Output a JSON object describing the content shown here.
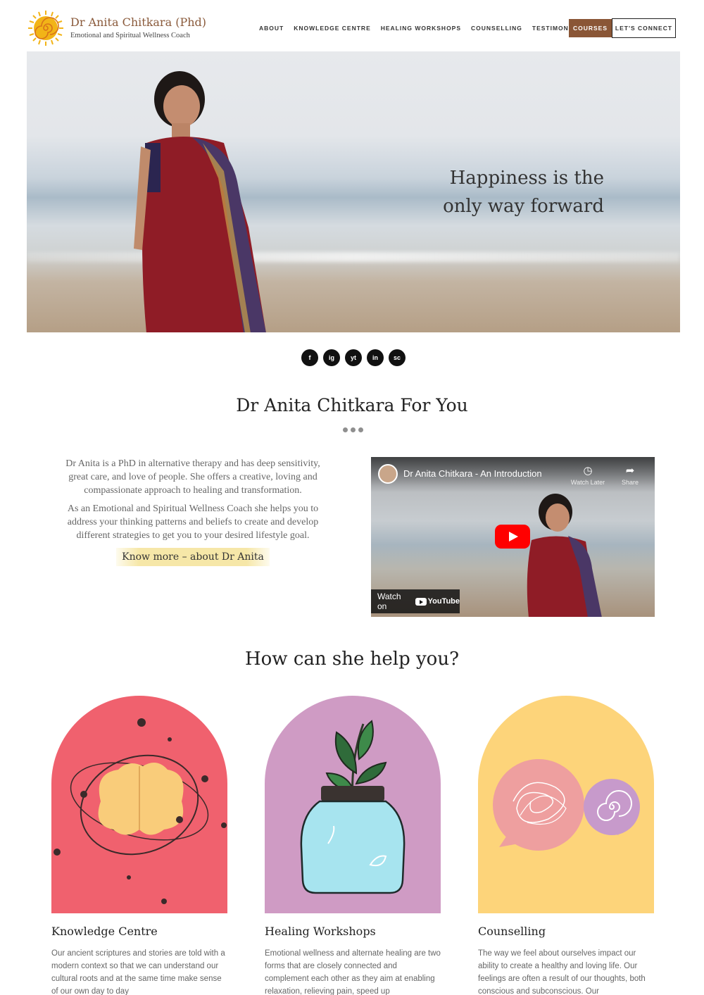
{
  "header": {
    "brand_title": "Dr Anita Chitkara (Phd)",
    "brand_subtitle": "Emotional and Spiritual Wellness Coach",
    "nav": [
      "ABOUT",
      "KNOWLEDGE CENTRE",
      "HEALING WORKSHOPS",
      "COUNSELLING",
      "TESTIMONIALS"
    ],
    "courses_label": "COURSES",
    "connect_label": "LET'S CONNECT"
  },
  "hero": {
    "quote_line1": "Happiness is the",
    "quote_line2": "only way forward"
  },
  "socials": [
    "f",
    "ig",
    "yt",
    "in",
    "sc"
  ],
  "about": {
    "title": "Dr Anita Chitkara For You",
    "paragraph1": "Dr Anita is a PhD in alternative therapy and has deep sensitivity, great care, and love of people. She offers a creative, loving and compassionate approach to healing and transformation.",
    "paragraph2": "As an Emotional and Spiritual Wellness Coach she helps you to address your thinking patterns and beliefs to create and develop different strategies to get you to your desired lifestyle goal.",
    "know_more": "Know more – about Dr Anita"
  },
  "video": {
    "title": "Dr Anita Chitkara - An Introduction",
    "watch_later": "Watch Later",
    "share": "Share",
    "watch_on": "Watch on",
    "youtube": "YouTube"
  },
  "help": {
    "title": "How can she help you?",
    "cards": [
      {
        "title": "Knowledge Centre",
        "text": "Our ancient scriptures and stories are told with a modern context so that we can understand our cultural roots and at the same time make sense of our own day to day",
        "color": "#f0616e"
      },
      {
        "title": "Healing Workshops",
        "text": "Emotional wellness and alternate healing are two forms that are closely connected and complement each other as they aim at enabling relaxation, relieving pain, speed up",
        "color": "#cf9bc4"
      },
      {
        "title": "Counselling",
        "text": "The way we feel about ourselves impact our ability to create a healthy and loving life. Our feelings are often a result of our thoughts, both conscious and subconscious. Our",
        "color": "#fdd47a"
      }
    ]
  }
}
